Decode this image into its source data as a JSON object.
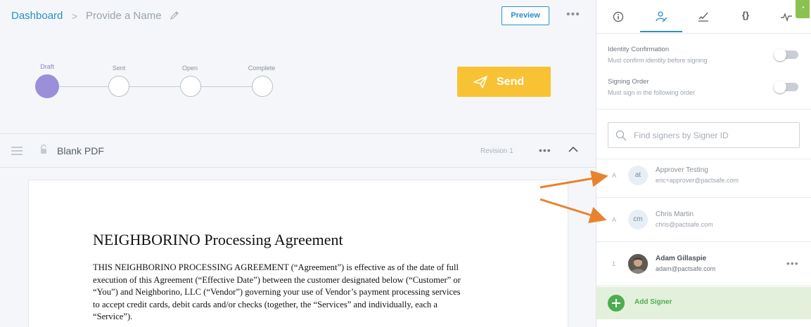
{
  "breadcrumb": {
    "dashboard": "Dashboard",
    "separator": ">",
    "name": "Provide a Name"
  },
  "header": {
    "preview_label": "Preview",
    "more": "•••"
  },
  "stepper": {
    "active_step": "Draft",
    "steps": [
      {
        "label": "Draft"
      },
      {
        "label": "Sent"
      },
      {
        "label": "Open"
      },
      {
        "label": "Complete"
      }
    ]
  },
  "send": {
    "label": "Send",
    "icon": "paper-plane-icon",
    "color": "#f8c235"
  },
  "document": {
    "title": "Blank PDF",
    "revision": "Revision 1",
    "more": "•••",
    "paper_title": "NEIGHBORINO Processing Agreement",
    "paper_lines": [
      "THIS NEIGHBORINO PROCESSING AGREEMENT (“Agreement”) is effective as of the date of full",
      "execution of this Agreement (“Effective Date”) between the customer designated below (“Customer”  or",
      "“You”) and Neighborino, LLC (“Vendor”) governing your use of Vendor’s payment processing services",
      "to accept credit cards, debit cards and/or checks (together, the “Services” and individually, each a",
      "“Service”)."
    ]
  },
  "panel": {
    "tabs": [
      {
        "icon": "info-icon",
        "glyph": "ⓘ"
      },
      {
        "icon": "signers-icon",
        "glyph": ""
      },
      {
        "icon": "signature-icon",
        "glyph": ""
      },
      {
        "icon": "variables-icon",
        "glyph": "{}"
      },
      {
        "icon": "activity-icon",
        "glyph": ""
      }
    ],
    "active_tab": "signers",
    "identity": {
      "title": "Identity Confirmation",
      "desc": "Must confirm identity before signing",
      "enabled": false
    },
    "order": {
      "title": "Signing Order",
      "desc": "Must sign in the following order",
      "enabled": false
    },
    "search_placeholder": "Find signers by Signer ID",
    "signers": [
      {
        "order": "A",
        "initials": "at",
        "name": "Approver Testing",
        "email": "eric+approver@pactsafe.com"
      },
      {
        "order": "A",
        "initials": "cm",
        "name": "Chris Martin",
        "email": "chris@pactsafe.com"
      },
      {
        "order": "1",
        "initials": "",
        "name": "Adam Gillaspie",
        "email": "adam@pactsafe.com",
        "more": "•••"
      }
    ],
    "add_signer_label": "Add Signer",
    "accent_color": "#2b8fc9",
    "add_color": "#4cae4f"
  },
  "annotation": {
    "arrow_color": "#e8822b"
  }
}
